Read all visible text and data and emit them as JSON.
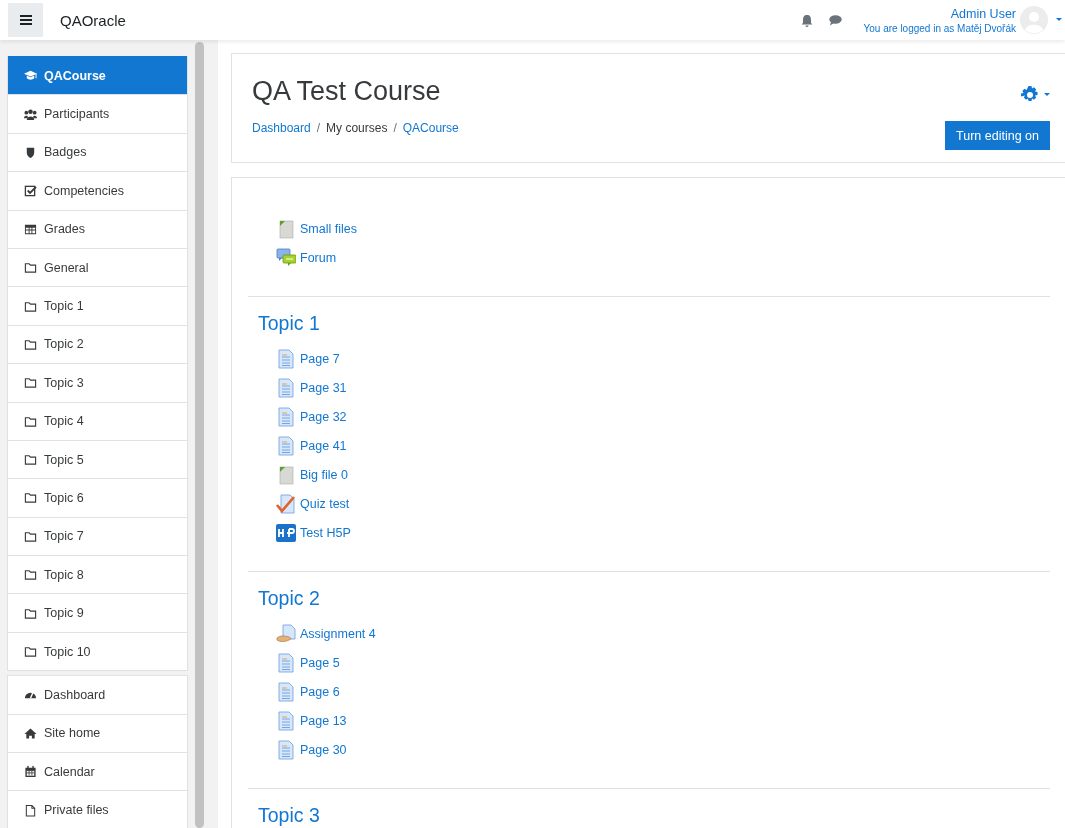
{
  "navbar": {
    "site_name": "QAOracle",
    "user_name": "Admin User",
    "login_info": "You are logged in as Matěj Dvořák"
  },
  "sidebar": {
    "groups": [
      {
        "items": [
          {
            "label": "QACourse",
            "kind": "course",
            "selected": true
          },
          {
            "label": "Participants",
            "kind": "users",
            "selected": false
          },
          {
            "label": "Badges",
            "kind": "shield",
            "selected": false
          },
          {
            "label": "Competencies",
            "kind": "checkbox",
            "selected": false
          },
          {
            "label": "Grades",
            "kind": "table",
            "selected": false
          },
          {
            "label": "General",
            "kind": "folder",
            "selected": false
          },
          {
            "label": "Topic 1",
            "kind": "folder",
            "selected": false
          },
          {
            "label": "Topic 2",
            "kind": "folder",
            "selected": false
          },
          {
            "label": "Topic 3",
            "kind": "folder",
            "selected": false
          },
          {
            "label": "Topic 4",
            "kind": "folder",
            "selected": false
          },
          {
            "label": "Topic 5",
            "kind": "folder",
            "selected": false
          },
          {
            "label": "Topic 6",
            "kind": "folder",
            "selected": false
          },
          {
            "label": "Topic 7",
            "kind": "folder",
            "selected": false
          },
          {
            "label": "Topic 8",
            "kind": "folder",
            "selected": false
          },
          {
            "label": "Topic 9",
            "kind": "folder",
            "selected": false
          },
          {
            "label": "Topic 10",
            "kind": "folder",
            "selected": false
          }
        ]
      },
      {
        "items": [
          {
            "label": "Dashboard",
            "kind": "gauge",
            "selected": false
          },
          {
            "label": "Site home",
            "kind": "home",
            "selected": false
          },
          {
            "label": "Calendar",
            "kind": "calendar",
            "selected": false
          },
          {
            "label": "Private files",
            "kind": "file",
            "selected": false
          }
        ]
      }
    ]
  },
  "course": {
    "title": "QA Test Course",
    "separator": "/",
    "breadcrumb": [
      {
        "label": "Dashboard",
        "link": true
      },
      {
        "label": "My courses",
        "link": false
      },
      {
        "label": "QACourse",
        "link": true
      }
    ],
    "edit_button": "Turn editing on"
  },
  "sections": [
    {
      "activities": [
        {
          "label": "Small files",
          "kind": "file"
        },
        {
          "label": "Forum",
          "kind": "forum"
        }
      ]
    },
    {
      "title": "Topic 1",
      "activities": [
        {
          "label": "Page 7",
          "kind": "page"
        },
        {
          "label": "Page 31",
          "kind": "page"
        },
        {
          "label": "Page 32",
          "kind": "page"
        },
        {
          "label": "Page 41",
          "kind": "page"
        },
        {
          "label": "Big file 0",
          "kind": "file"
        },
        {
          "label": "Quiz test",
          "kind": "quiz"
        },
        {
          "label": "Test H5P",
          "kind": "h5p"
        }
      ]
    },
    {
      "title": "Topic 2",
      "activities": [
        {
          "label": "Assignment 4",
          "kind": "assign"
        },
        {
          "label": "Page 5",
          "kind": "page"
        },
        {
          "label": "Page 6",
          "kind": "page"
        },
        {
          "label": "Page 13",
          "kind": "page"
        },
        {
          "label": "Page 30",
          "kind": "page"
        }
      ]
    },
    {
      "title": "Topic 3"
    }
  ]
}
